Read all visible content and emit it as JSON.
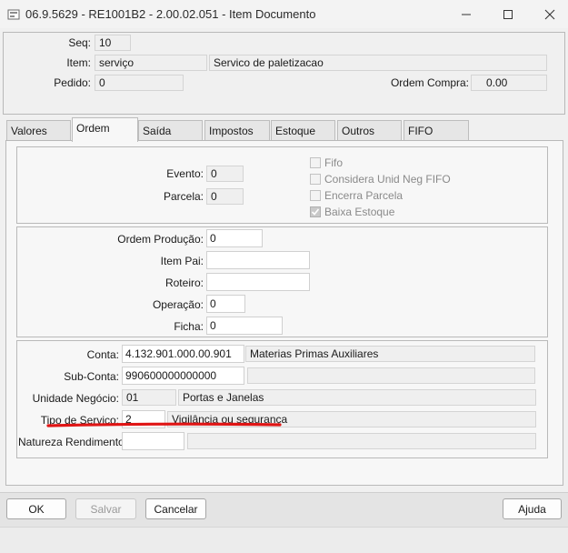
{
  "window": {
    "title": "06.9.5629 - RE1001B2 - 2.00.02.051 - Item Documento"
  },
  "header": {
    "seq_label": "Seq:",
    "seq_value": "10",
    "item_label": "Item:",
    "item_code": "serviço",
    "item_desc": "Servico de paletizacao",
    "pedido_label": "Pedido:",
    "pedido_value": "0",
    "ordem_compra_label": "Ordem Compra:",
    "ordem_compra_value": "0.00"
  },
  "tabs": [
    {
      "label": "Valores"
    },
    {
      "label": "Ordem"
    },
    {
      "label": "Saída"
    },
    {
      "label": "Impostos"
    },
    {
      "label": "Estoque"
    },
    {
      "label": "Outros"
    },
    {
      "label": "FIFO"
    }
  ],
  "group1": {
    "evento_label": "Evento:",
    "evento_value": "0",
    "parcela_label": "Parcela:",
    "parcela_value": "0",
    "fifo_label": "Fifo",
    "considera_label": "Considera Unid Neg FIFO",
    "encerra_label": "Encerra Parcela",
    "baixa_label": "Baixa Estoque",
    "baixa_checked": true
  },
  "group2": {
    "ordem_producao_label": "Ordem Produção:",
    "ordem_producao_value": "0",
    "item_pai_label": "Item Pai:",
    "item_pai_value": "",
    "roteiro_label": "Roteiro:",
    "roteiro_value": "",
    "operacao_label": "Operação:",
    "operacao_value": "0",
    "ficha_label": "Ficha:",
    "ficha_value": "0"
  },
  "group3": {
    "conta_label": "Conta:",
    "conta_value": "4.132.901.000.00.901",
    "conta_desc": "Materias Primas Auxiliares",
    "subconta_label": "Sub-Conta:",
    "subconta_value": "990600000000000",
    "subconta_desc": "",
    "unidade_label": "Unidade Negócio:",
    "unidade_value": "01",
    "unidade_desc": "Portas e Janelas",
    "tipo_servico_label": "Tipo de Servico:",
    "tipo_servico_value": "2",
    "tipo_servico_desc": "Vigilância ou segurança",
    "natureza_label": "Natureza Rendimento:",
    "natureza_value": "",
    "natureza_desc": ""
  },
  "buttons": {
    "ok": "OK",
    "salvar": "Salvar",
    "cancelar": "Cancelar",
    "ajuda": "Ajuda"
  },
  "colors": {
    "annotation_underline": "#e01515"
  }
}
